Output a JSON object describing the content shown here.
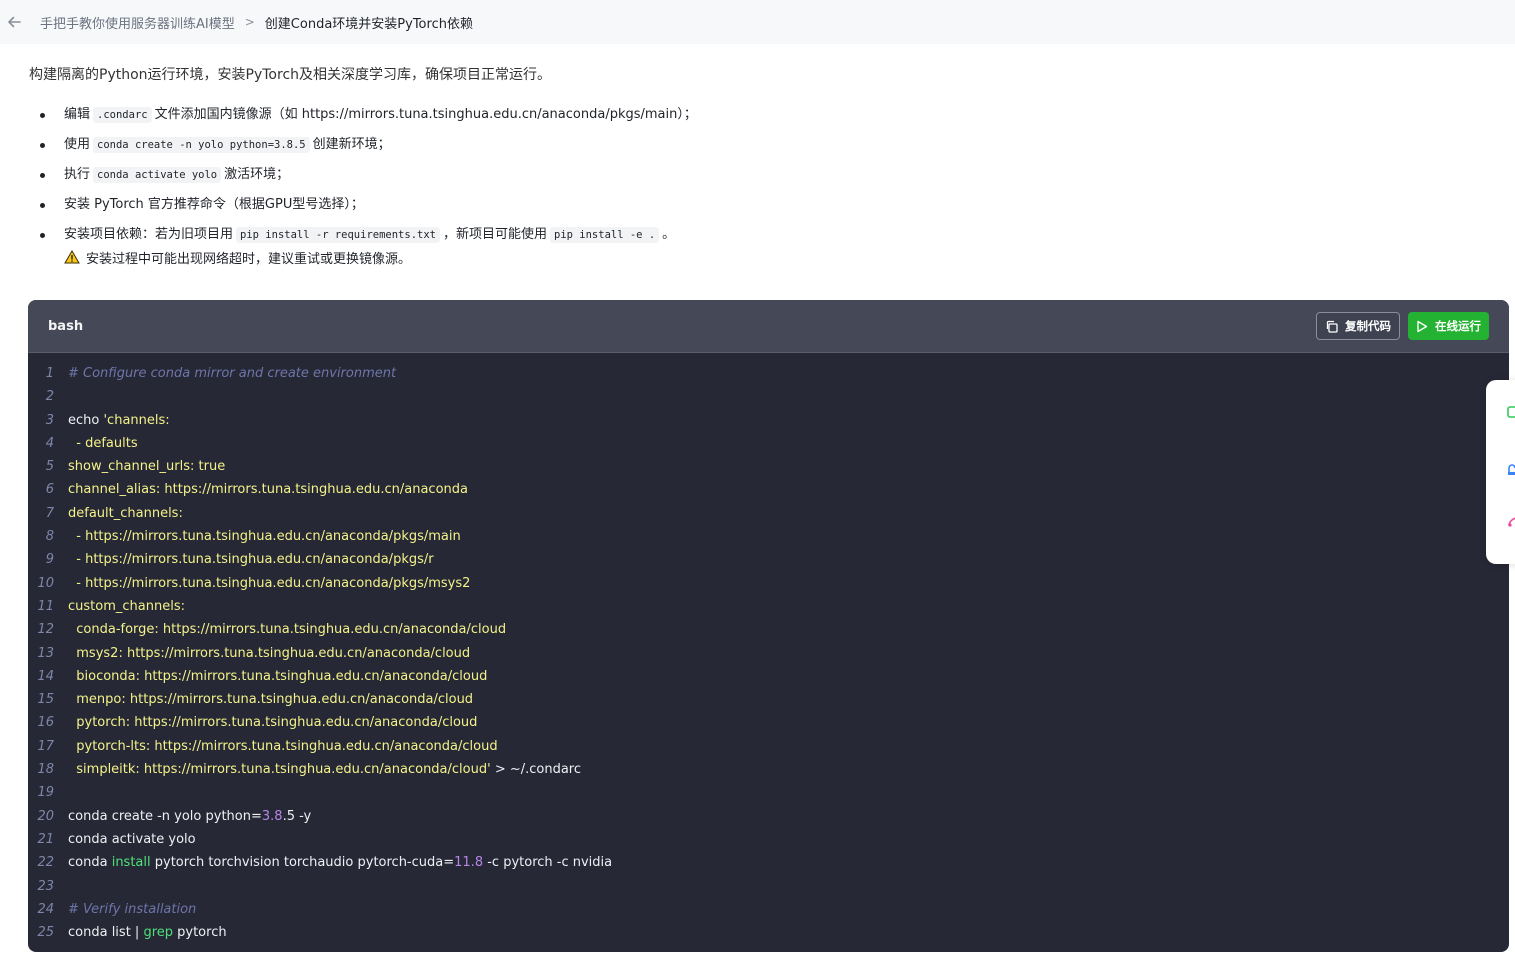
{
  "breadcrumb": {
    "parent": "手把手教你使用服务器训练AI模型",
    "separator": ">",
    "current": "创建Conda环境并安装PyTorch依赖"
  },
  "intro": "构建隔离的Python运行环境，安装PyTorch及相关深度学习库，确保项目正常运行。",
  "steps": [
    {
      "a": "编辑",
      "c1": ".condarc",
      "b": "文件添加国内镜像源（如 https://mirrors.tuna.tsinghua.edu.cn/anaconda/pkgs/main）；"
    },
    {
      "a": "使用",
      "c1": "conda create -n yolo python=3.8.5",
      "b": "创建新环境；"
    },
    {
      "a": "执行",
      "c1": "conda activate yolo",
      "b": "激活环境；"
    },
    {
      "a": "安装 PyTorch 官方推荐命令（根据GPU型号选择）；"
    },
    {
      "a": "安装项目依赖：若为旧项目用",
      "c1": "pip install -r requirements.txt",
      "b": "，新项目可能使用",
      "c2": "pip install -e .",
      "d": "。"
    }
  ],
  "warning": "安装过程中可能出现网络超时，建议重试或更换镜像源。",
  "code": {
    "language": "bash",
    "copy_label": "复制代码",
    "run_label": "在线运行",
    "lines": [
      [
        [
          "cm",
          "# Configure conda mirror and create environment"
        ]
      ],
      [],
      [
        [
          "pl",
          "echo "
        ],
        [
          "str",
          "'channels:"
        ]
      ],
      [
        [
          "str",
          "  - defaults"
        ]
      ],
      [
        [
          "str",
          "show_channel_urls: true"
        ]
      ],
      [
        [
          "str",
          "channel_alias: https://mirrors.tuna.tsinghua.edu.cn/anaconda"
        ]
      ],
      [
        [
          "str",
          "default_channels:"
        ]
      ],
      [
        [
          "str",
          "  - https://mirrors.tuna.tsinghua.edu.cn/anaconda/pkgs/main"
        ]
      ],
      [
        [
          "str",
          "  - https://mirrors.tuna.tsinghua.edu.cn/anaconda/pkgs/r"
        ]
      ],
      [
        [
          "str",
          "  - https://mirrors.tuna.tsinghua.edu.cn/anaconda/pkgs/msys2"
        ]
      ],
      [
        [
          "str",
          "custom_channels:"
        ]
      ],
      [
        [
          "str",
          "  conda-forge: https://mirrors.tuna.tsinghua.edu.cn/anaconda/cloud"
        ]
      ],
      [
        [
          "str",
          "  msys2: https://mirrors.tuna.tsinghua.edu.cn/anaconda/cloud"
        ]
      ],
      [
        [
          "str",
          "  bioconda: https://mirrors.tuna.tsinghua.edu.cn/anaconda/cloud"
        ]
      ],
      [
        [
          "str",
          "  menpo: https://mirrors.tuna.tsinghua.edu.cn/anaconda/cloud"
        ]
      ],
      [
        [
          "str",
          "  pytorch: https://mirrors.tuna.tsinghua.edu.cn/anaconda/cloud"
        ]
      ],
      [
        [
          "str",
          "  pytorch-lts: https://mirrors.tuna.tsinghua.edu.cn/anaconda/cloud"
        ]
      ],
      [
        [
          "str",
          "  simpleitk: https://mirrors.tuna.tsinghua.edu.cn/anaconda/cloud'"
        ],
        [
          "pl",
          " > ~/.condarc"
        ]
      ],
      [],
      [
        [
          "pl",
          "conda create -n yolo python="
        ],
        [
          "num",
          "3.8"
        ],
        [
          "pl",
          ".5 -y"
        ]
      ],
      [
        [
          "pl",
          "conda activate yolo"
        ]
      ],
      [
        [
          "pl",
          "conda "
        ],
        [
          "kw",
          "install"
        ],
        [
          "pl",
          " pytorch torchvision torchaudio pytorch-cuda="
        ],
        [
          "num",
          "11.8"
        ],
        [
          "pl",
          " -c pytorch -c nvidia"
        ]
      ],
      [],
      [
        [
          "cm",
          "# Verify installation"
        ]
      ],
      [
        [
          "pl",
          "conda list | "
        ],
        [
          "kw",
          "grep"
        ],
        [
          "pl",
          " pytorch"
        ]
      ]
    ]
  },
  "colors": {
    "code_bg": "#262836",
    "code_header_bg": "#454857",
    "run_button": "#24b232",
    "string": "#f4f28a",
    "comment": "#6d76a8",
    "number": "#b685e8",
    "keyword": "#50e07a"
  },
  "icons": [
    "back-arrow-icon",
    "warning-icon",
    "copy-icon",
    "play-icon",
    "side-tool-icon"
  ]
}
